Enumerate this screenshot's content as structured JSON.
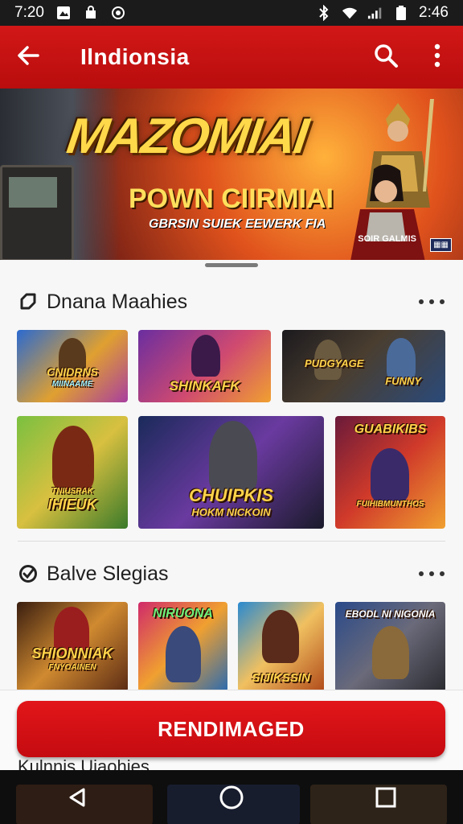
{
  "status_bar": {
    "time": "7:20",
    "clock_right": "2:46",
    "left_icons": [
      "gallery-icon",
      "bag-icon",
      "camera-icon"
    ],
    "right_icons": [
      "bluetooth-icon",
      "wifi-icon",
      "signal-icon",
      "battery-icon"
    ]
  },
  "app_bar": {
    "title": "Ilndionsia",
    "back_icon": "back-arrow-icon",
    "actions": [
      "search-icon",
      "more-vert-icon"
    ]
  },
  "banner": {
    "title": "MAZOMIAI",
    "subtitle": "POWN CIIRMIAI",
    "tagline": "GBRSIN SUIEK EEWERK FIA",
    "caption": "SOIR GALMIS"
  },
  "sections": [
    {
      "title": "Dnana Maahies",
      "tiles": [
        {
          "label": "CNIDRNS",
          "sub": "MIINAAME"
        },
        {
          "label": "SHINKAFK",
          "sub": ""
        },
        {
          "label": "PUDGYAGE",
          "sub": "FUNNY"
        },
        {
          "label": "IHIEUK",
          "sub": "TNIUSRAK"
        },
        {
          "label": "CHUIPKIS",
          "sub": "HOKM  NICKOIN"
        },
        {
          "label": "GUABIKIBS",
          "sub": "FUIHIBMUNTHOS"
        }
      ]
    },
    {
      "title": "Balve Slegias",
      "tiles": [
        {
          "label": "SHIONNIAK",
          "sub": "FNYOAINEN"
        },
        {
          "label": "NIRUONA",
          "sub": ""
        },
        {
          "label": "SIJIKSSIN",
          "sub": ""
        },
        {
          "label": "EBODL NI NIGONIA",
          "sub": ""
        }
      ]
    }
  ],
  "cta": {
    "label": "RENDIMAGED"
  },
  "peek_title": "Kulnnis Uiaohies",
  "nav_bar": {
    "buttons": [
      "back-triangle-icon",
      "home-circle-icon",
      "recents-square-icon"
    ]
  },
  "colors": {
    "accent": "#cc1212",
    "dark": "#1b1b1b",
    "sheet": "#f7f7f7"
  }
}
